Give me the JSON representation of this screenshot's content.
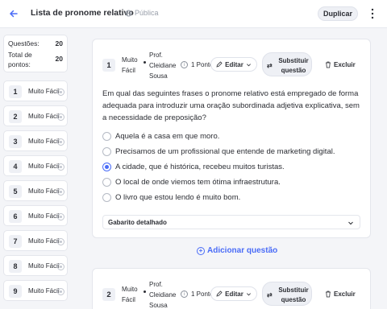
{
  "header": {
    "title": "Lista de pronome relativo",
    "visibility": "Pública",
    "duplicate_label": "Duplicar"
  },
  "stats": {
    "questions_label": "Questões:",
    "questions_value": "20",
    "points_label": "Total de pontos:",
    "points_value": "20"
  },
  "question_nav": [
    {
      "number": "1",
      "difficulty": "Muito Fácil"
    },
    {
      "number": "2",
      "difficulty": "Muito Fácil"
    },
    {
      "number": "3",
      "difficulty": "Muito Fácil"
    },
    {
      "number": "4",
      "difficulty": "Muito Fácil"
    },
    {
      "number": "5",
      "difficulty": "Muito Fácil"
    },
    {
      "number": "6",
      "difficulty": "Muito Fácil"
    },
    {
      "number": "7",
      "difficulty": "Muito Fácil"
    },
    {
      "number": "8",
      "difficulty": "Muito Fácil"
    },
    {
      "number": "9",
      "difficulty": "Muito Fácil"
    }
  ],
  "questions": [
    {
      "number": "1",
      "difficulty": "Muito Fácil",
      "author": "Prof. Cleidiane Sousa",
      "points": "1 Ponto",
      "edit_label": "Editar",
      "replace_label": "Substituir questão",
      "delete_label": "Excluir",
      "text": "Em qual das seguintes frases o pronome relativo está empregado de forma adequada para introduzir uma oração subordinada adjetiva explicativa, sem a necessidade de preposição?",
      "alternatives": [
        {
          "text": "Aquela é a casa em que moro.",
          "selected": false
        },
        {
          "text": "Precisamos de um profissional que entende de marketing digital.",
          "selected": false
        },
        {
          "text": "A cidade, que é histórica, recebeu muitos turistas.",
          "selected": true
        },
        {
          "text": "O local de onde viemos tem ótima infraestrutura.",
          "selected": false
        },
        {
          "text": "O livro que estou lendo é muito bom.",
          "selected": false
        }
      ],
      "answer_key_label": "Gabarito detalhado"
    },
    {
      "number": "2",
      "difficulty": "Muito Fácil",
      "author": "Prof. Cleidiane Sousa",
      "points": "1 Ponto",
      "edit_label": "Editar",
      "replace_label": "Substituir questão",
      "delete_label": "Excluir"
    }
  ],
  "add_question_label": "Adicionar questão",
  "colors": {
    "accent": "#4a6cf7",
    "background": "#f4f5f8"
  }
}
